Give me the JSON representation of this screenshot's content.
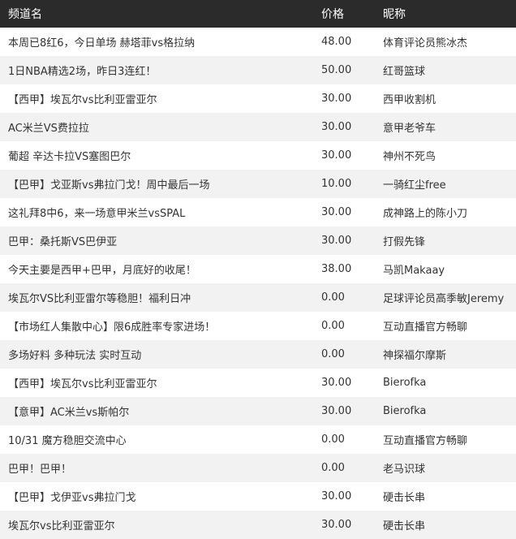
{
  "header": {
    "channel": "频道名",
    "price": "价格",
    "nickname": "昵称"
  },
  "rows": [
    {
      "channel": "本周已8红6，今日单场 赫塔菲vs格拉纳",
      "price": "48.00",
      "nickname": "体育评论员熊冰杰"
    },
    {
      "channel": "1日NBA精选2场，昨日3连红！",
      "price": "50.00",
      "nickname": "红哥篮球"
    },
    {
      "channel": "【西甲】埃瓦尔vs比利亚雷亚尔",
      "price": "30.00",
      "nickname": "西甲收割机"
    },
    {
      "channel": "AC米兰VS费拉拉",
      "price": "30.00",
      "nickname": "意甲老爷车"
    },
    {
      "channel": "葡超 辛达卡拉VS塞图巴尔",
      "price": "30.00",
      "nickname": "神州不死鸟"
    },
    {
      "channel": "【巴甲】戈亚斯vs弗拉门戈！周中最后一场",
      "price": "10.00",
      "nickname": "一骑红尘free"
    },
    {
      "channel": "这礼拜8中6，来一场意甲米兰vsSPAL",
      "price": "30.00",
      "nickname": "成神路上的陈小刀"
    },
    {
      "channel": "巴甲：桑托斯VS巴伊亚",
      "price": "30.00",
      "nickname": "打假先锋"
    },
    {
      "channel": "今天主要是西甲+巴甲，月底好的收尾！",
      "price": "38.00",
      "nickname": "马凯Makaay"
    },
    {
      "channel": "埃瓦尔VS比利亚雷尔等稳胆！福利日冲",
      "price": "0.00",
      "nickname": "足球评论员高季敏Jeremy"
    },
    {
      "channel": "【市场红人集散中心】限6成胜率专家进场！",
      "price": "0.00",
      "nickname": "互动直播官方畅聊"
    },
    {
      "channel": "多场好料 多种玩法 实时互动",
      "price": "0.00",
      "nickname": "神探福尔摩斯"
    },
    {
      "channel": "【西甲】埃瓦尔vs比利亚雷亚尔",
      "price": "30.00",
      "nickname": "Bierofka"
    },
    {
      "channel": "【意甲】AC米兰vs斯帕尔",
      "price": "30.00",
      "nickname": "Bierofka"
    },
    {
      "channel": "10/31 魔方稳胆交流中心",
      "price": "0.00",
      "nickname": "互动直播官方畅聊"
    },
    {
      "channel": "巴甲！巴甲！",
      "price": "0.00",
      "nickname": "老马识球"
    },
    {
      "channel": "【巴甲】戈伊亚vs弗拉门戈",
      "price": "30.00",
      "nickname": "硬击长串"
    },
    {
      "channel": "埃瓦尔vs比利亚雷亚尔",
      "price": "30.00",
      "nickname": "硬击长串"
    }
  ]
}
